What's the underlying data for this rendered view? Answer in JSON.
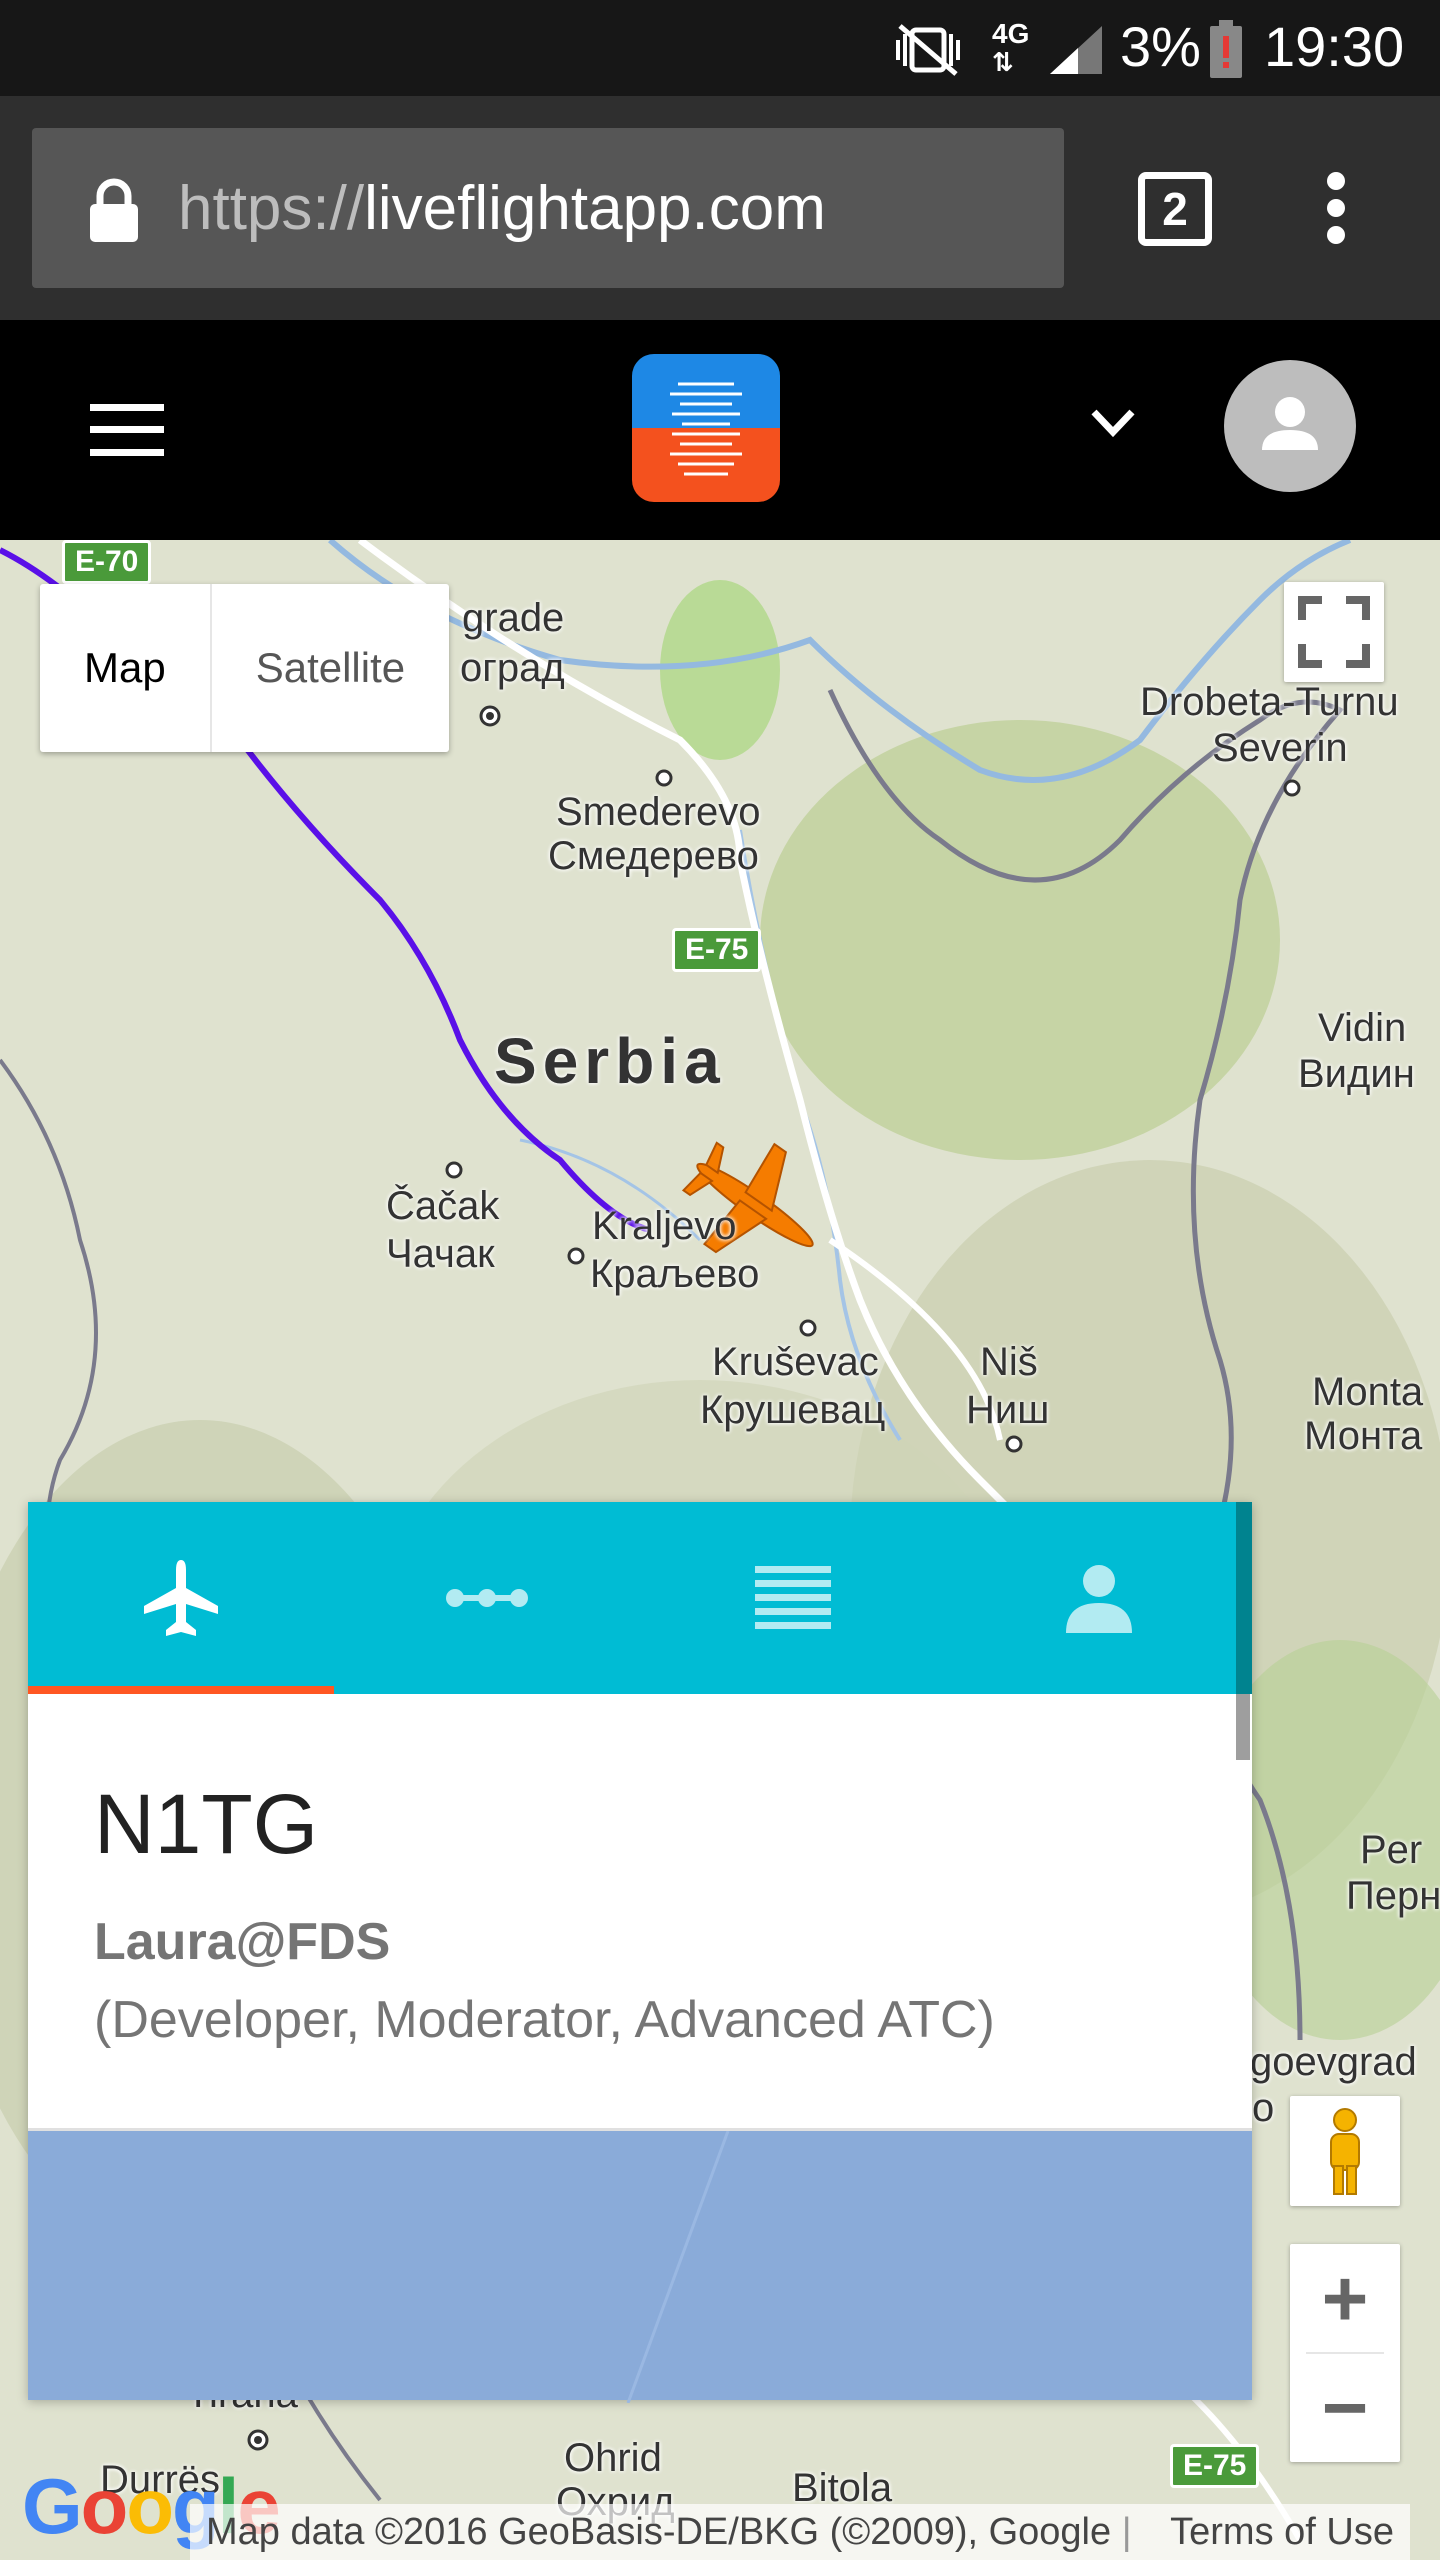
{
  "status_bar": {
    "battery": "3%",
    "time": "19:30",
    "network": "4G",
    "icons": [
      "mute-vibrate-icon",
      "network-4g-icon",
      "signal-icon",
      "battery-low-icon"
    ]
  },
  "browser": {
    "url_prefix": "https://",
    "url_domain": "liveflightapp.com",
    "tab_count": "2"
  },
  "app_header": {
    "logo_colors": [
      "#1e88e5",
      "#f4511e"
    ]
  },
  "map": {
    "type_buttons": [
      "Map",
      "Satellite"
    ],
    "selected_type": "Map",
    "labels": {
      "belgrade_lat": "grade",
      "belgrade_cyr": "оград",
      "smederevo_lat": "Smederevo",
      "smederevo_cyr": "Смедерево",
      "serbia": "Serbia",
      "cacak_lat": "Čačak",
      "cacak_cyr": "Чачак",
      "kraljevo_lat": "Kraljevo",
      "kraljevo_cyr": "Краљево",
      "krusevac_lat": "Kruševac",
      "krusevac_cyr": "Крушевац",
      "nis_lat": "Niš",
      "nis_cyr": "Ниш",
      "drobeta": "Drobeta-Turnu",
      "severin": "Severin",
      "vidin_lat": "Vidin",
      "vidin_cyr": "Видин",
      "monta_lat": "Monta",
      "monta_cyr": "Монта",
      "pern_lat": "Per",
      "pern_cyr": "Перн",
      "goev_lat": "goevgrad",
      "goev_cyr": "о",
      "tirana": "Tirana",
      "durres": "Durrës",
      "ohrid_lat": "Ohrid",
      "ohrid_cyr": "Охрид",
      "bitola": "Bitola"
    },
    "road_shields": [
      "E-70",
      "E-75",
      "E-75"
    ],
    "attribution": "Map data ©2016 GeoBasis-DE/BKG (©2009), Google",
    "terms": "Terms of Use",
    "google_logo": "Google",
    "zoom_in": "+",
    "zoom_out": "−",
    "route_color": "#5a10e8",
    "aircraft_color": "#f57c00"
  },
  "flight_panel": {
    "tabs": [
      {
        "icon": "airplane-icon",
        "active": true
      },
      {
        "icon": "route-icon",
        "active": false
      },
      {
        "icon": "list-icon",
        "active": false
      },
      {
        "icon": "person-icon",
        "active": false
      }
    ],
    "accent_color": "#00bcd4",
    "indicator_color": "#ff5722",
    "callsign": "N1TG",
    "username": "Laura@FDS",
    "roles": "(Developer, Moderator, Advanced ATC)"
  }
}
